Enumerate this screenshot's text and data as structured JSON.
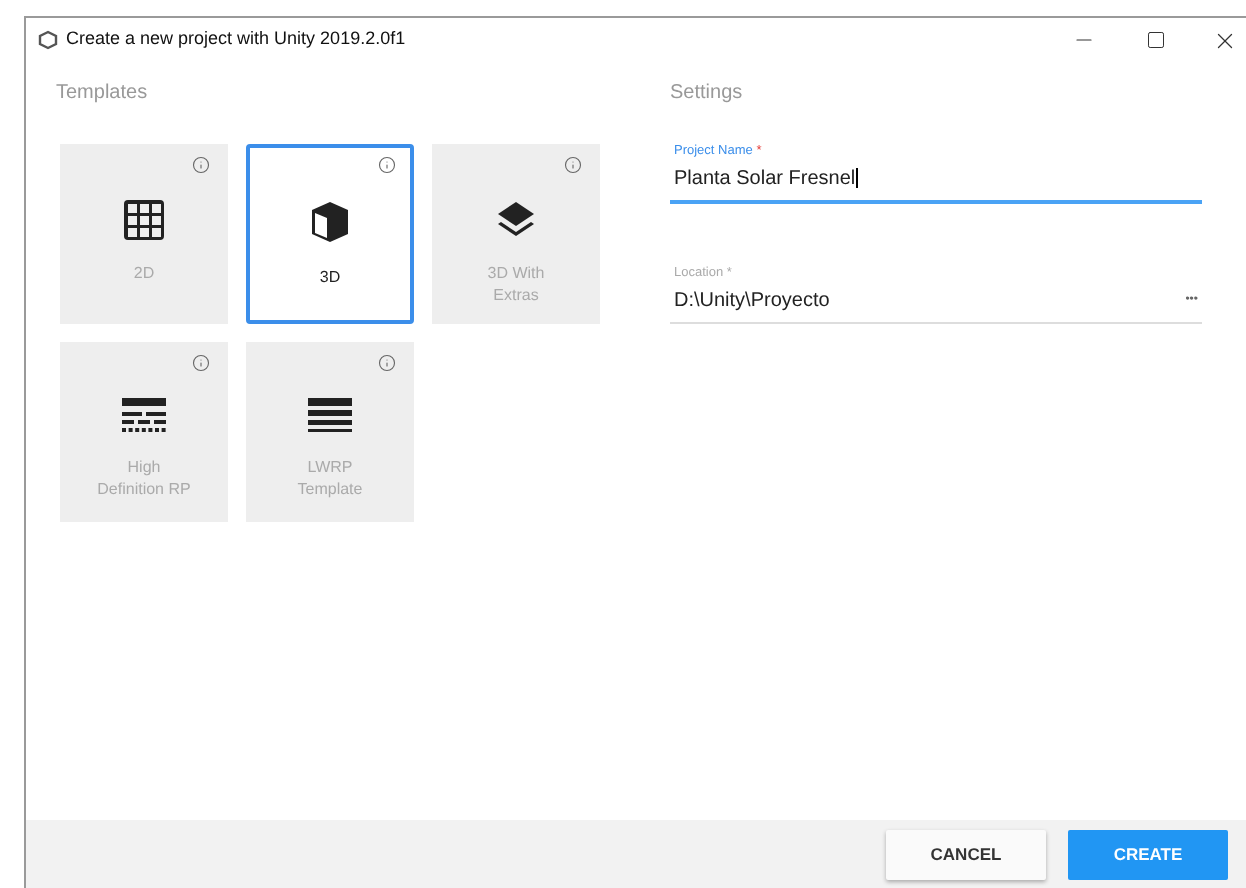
{
  "window": {
    "title": "Create a new project with Unity 2019.2.0f1"
  },
  "templates": {
    "heading": "Templates",
    "items": [
      {
        "label": "2D",
        "kind": "grid",
        "selected": false
      },
      {
        "label": "3D",
        "kind": "cube",
        "selected": true
      },
      {
        "label": "3D With Extras",
        "kind": "layers",
        "selected": false
      },
      {
        "label": "High Definition RP",
        "kind": "hdrp",
        "selected": false
      },
      {
        "label": "LWRP Template",
        "kind": "lwrp",
        "selected": false
      }
    ]
  },
  "settings": {
    "heading": "Settings",
    "fields": [
      {
        "label": "Project Name",
        "required_mark": "*",
        "value": "Planta Solar Fresnel",
        "focused": true,
        "kind": "text"
      },
      {
        "label": "Location",
        "required_mark": "*",
        "value": "D:\\Unity\\Proyecto",
        "focused": false,
        "kind": "browse",
        "button": "•••"
      }
    ]
  },
  "buttons": [
    {
      "label": "CANCEL",
      "kind": "secondary"
    },
    {
      "label": "CREATE",
      "kind": "primary"
    }
  ]
}
